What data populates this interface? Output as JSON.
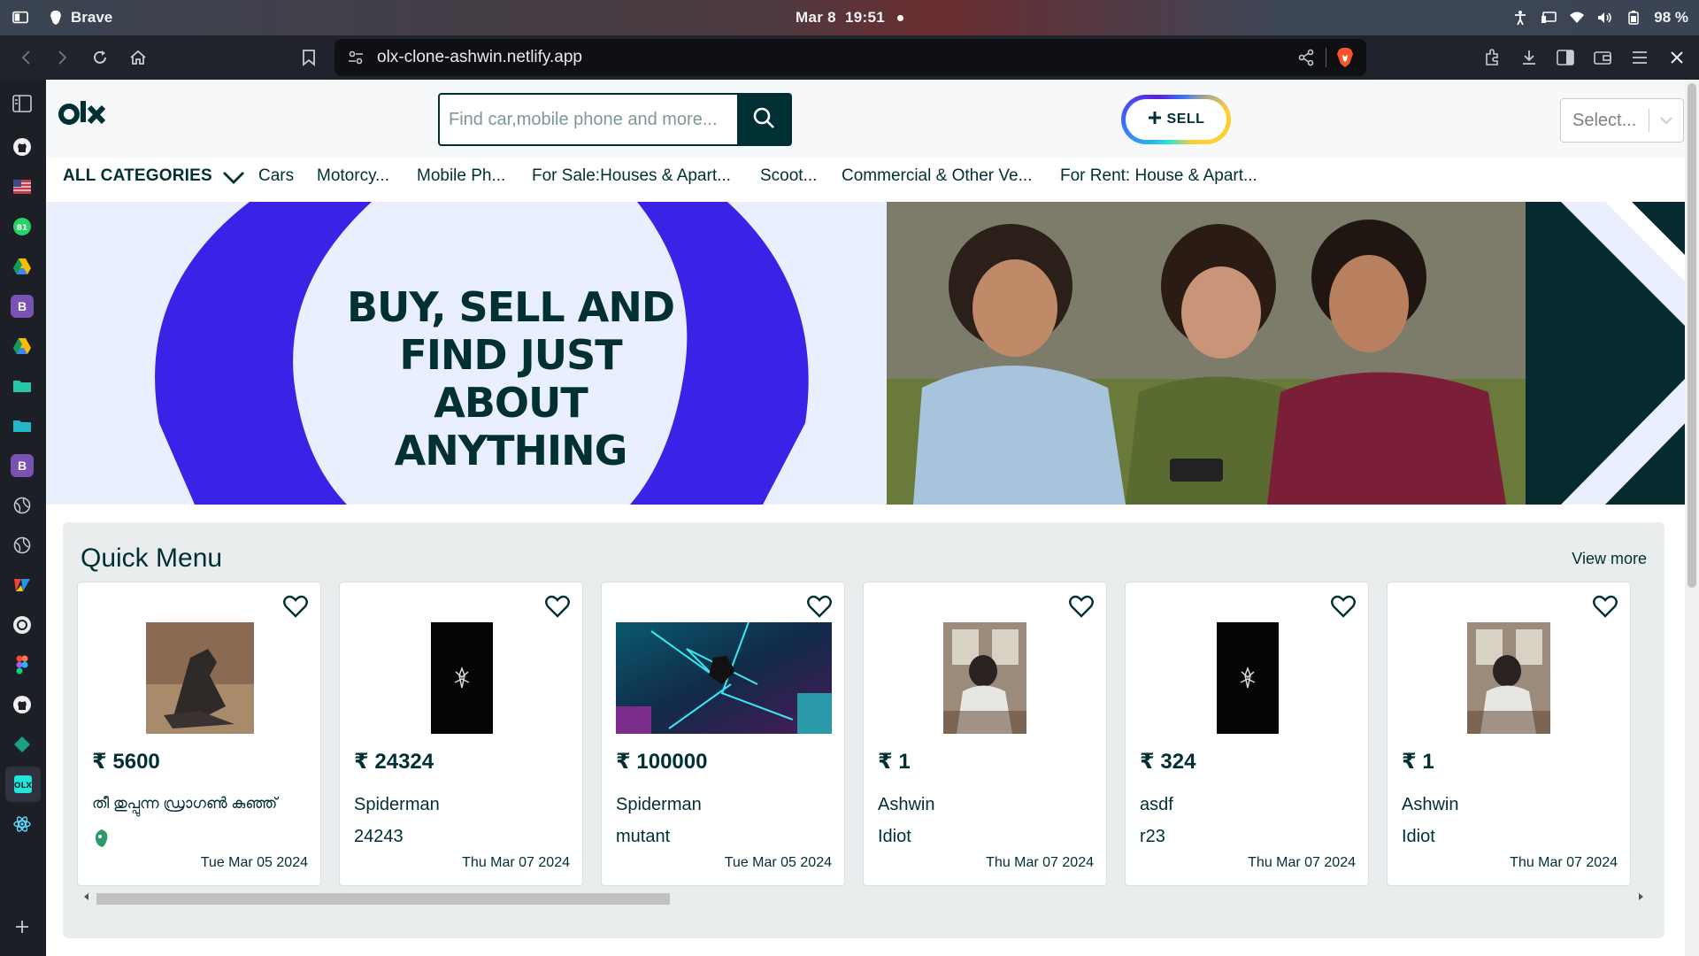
{
  "os": {
    "app_name": "Brave",
    "date": "Mar 8",
    "time": "19:51",
    "battery": "98 %"
  },
  "browser": {
    "url": "olx-clone-ashwin.netlify.app"
  },
  "site": {
    "search_placeholder": "Find car,mobile phone and more...",
    "sell_label": "SELL",
    "language_select": "Select...",
    "all_categories": "ALL CATEGORIES",
    "categories": [
      "Cars",
      "Motorcy...",
      "Mobile Ph...",
      "For Sale:Houses & Apart...",
      "Scoot...",
      "Commercial & Other Ve...",
      "For Rent: House & Apart..."
    ],
    "banner_lines": [
      "BUY, SELL AND",
      "FIND JUST ABOUT",
      "ANYTHING"
    ]
  },
  "quick_menu": {
    "title": "Quick Menu",
    "view_more": "View more",
    "items": [
      {
        "price": "₹ 5600",
        "title": "തീ തുപ്പുന്ന ഡ്രാഗൺ കുഞ്ഞ്",
        "description": "",
        "date": "Tue Mar 05 2024",
        "image": "dragon-figurine"
      },
      {
        "price": "₹ 24324",
        "title": "Spiderman",
        "description": "24243",
        "date": "Thu Mar 07 2024",
        "image": "spiderman-logo-dark"
      },
      {
        "price": "₹ 100000",
        "title": "Spiderman",
        "description": "mutant",
        "date": "Tue Mar 05 2024",
        "image": "spiderverse-art"
      },
      {
        "price": "₹ 1",
        "title": "Ashwin",
        "description": "Idiot",
        "date": "Thu Mar 07 2024",
        "image": "person-photo"
      },
      {
        "price": "₹ 324",
        "title": "asdf",
        "description": "r23",
        "date": "Thu Mar 07 2024",
        "image": "spiderman-logo-dark"
      },
      {
        "price": "₹ 1",
        "title": "Ashwin",
        "description": "Idiot",
        "date": "Thu Mar 07 2024",
        "image": "person-photo"
      }
    ]
  },
  "colors": {
    "olx_dark": "#002f34",
    "banner_ring": "#3a22e6",
    "sell_yellow": "#ffce32",
    "sell_blue": "#3a77ff",
    "sell_teal": "#23e5db"
  }
}
